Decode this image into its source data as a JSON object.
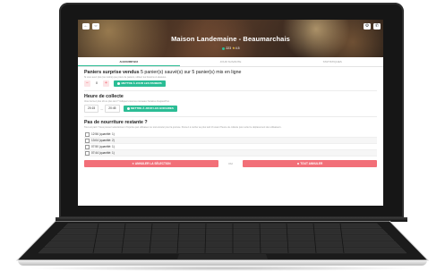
{
  "app": {
    "title": "Maison Landemaine - Beaumarchais",
    "rating_count": "223",
    "rating_value": "4.5",
    "header_icons": {
      "left": [
        "back-icon",
        "link-icon"
      ],
      "right": [
        "gear-icon",
        "phone-icon"
      ]
    }
  },
  "tabs": [
    {
      "label": "AUJOURD'HUI",
      "active": true
    },
    {
      "label": "JOUR SUIVANTE",
      "active": false
    },
    {
      "label": "STATISTIQUES",
      "active": false
    }
  ],
  "sold": {
    "title_bold": "Paniers surprise vendus",
    "title_rest": " 5 panier(s) sauvé(s) sur 5 panier(s) mis en ligne",
    "hint": "Si vous avez plus (ou moins) que prévu de paniers, utilisez les boutons ci-dessous.",
    "quantity": "0",
    "minus_label": "−",
    "plus_label": "+",
    "update_label": "METTRE À JOUR LES PANIERS"
  },
  "pickup": {
    "title": "Heure de collecte",
    "hint": "Vous fermez plus tôt ou plus tard ? Indiquez-nous les nouveaux horaires d'aujourd'hui.",
    "start": "20:15",
    "end": "20:45",
    "separator": "—",
    "update_label": "METTRE À JOUR LES HORAIRES"
  },
  "no_food": {
    "title": "Pas de nourriture restante ?",
    "hint": "Tout est parti ! Vous pouvez sélectionner n'importe quel utilisateur ou tout annuler pour la journée. Pensez à cocher au plus tard 1h avant l'heure de collecte pour éviter le déplacement des utilisateurs.",
    "orders": [
      {
        "label": "12:56 (quantité: 1)"
      },
      {
        "label": "13:04 (quantité: 2)"
      },
      {
        "label": "07:50 (quantité: 1)"
      },
      {
        "label": "07:44 (quantité: 1)"
      }
    ],
    "cancel_selection_label": "ANNULER LA SÉLECTION",
    "or_label": "OU",
    "cancel_all_label": "TOUT ANNULER"
  },
  "colors": {
    "accent": "#2bbd95",
    "danger": "#f26f78",
    "laptop_body": "#161616"
  }
}
